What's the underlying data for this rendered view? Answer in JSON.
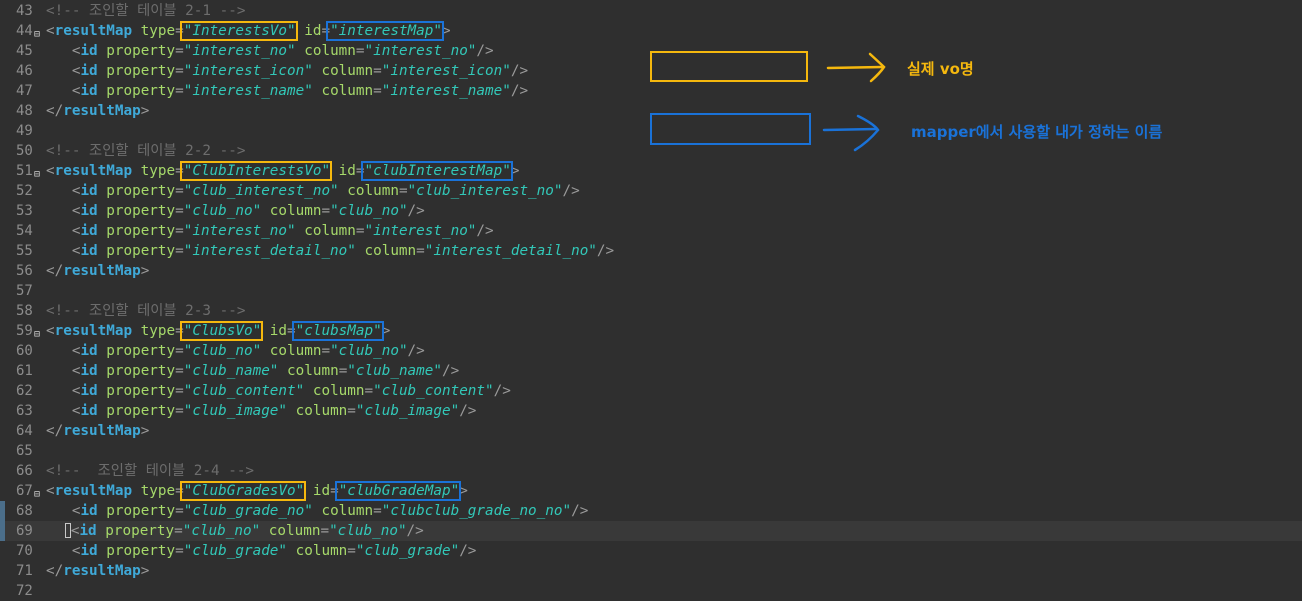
{
  "colors": {
    "vo_highlight": "#f5b80e",
    "mapper_highlight": "#1a72d8",
    "background": "#2f2f2f"
  },
  "legend": {
    "vo_label": "실제 vo명",
    "mapper_label": "mapper에서 사용할 내가 정하는 이름"
  },
  "lines": [
    {
      "n": "43",
      "comment": "<!-- 조인할 테이블 2-1 -->"
    },
    {
      "n": "44",
      "fold": true,
      "open": {
        "tag": "resultMap",
        "type": "InterestsVo",
        "id": "interestMap"
      }
    },
    {
      "n": "45",
      "id": {
        "property": "interest_no",
        "column": "interest_no"
      }
    },
    {
      "n": "46",
      "id": {
        "property": "interest_icon",
        "column": "interest_icon"
      }
    },
    {
      "n": "47",
      "id": {
        "property": "interest_name",
        "column": "interest_name"
      }
    },
    {
      "n": "48",
      "close": "resultMap"
    },
    {
      "n": "49"
    },
    {
      "n": "50",
      "comment": "<!-- 조인할 테이블 2-2 -->"
    },
    {
      "n": "51",
      "fold": true,
      "open": {
        "tag": "resultMap",
        "type": "ClubInterestsVo",
        "id": "clubInterestMap"
      }
    },
    {
      "n": "52",
      "id": {
        "property": "club_interest_no",
        "column": "club_interest_no"
      }
    },
    {
      "n": "53",
      "id": {
        "property": "club_no",
        "column": "club_no"
      }
    },
    {
      "n": "54",
      "id": {
        "property": "interest_no",
        "column": "interest_no"
      }
    },
    {
      "n": "55",
      "id": {
        "property": "interest_detail_no",
        "column": "interest_detail_no"
      }
    },
    {
      "n": "56",
      "close": "resultMap"
    },
    {
      "n": "57"
    },
    {
      "n": "58",
      "comment": "<!-- 조인할 테이블 2-3 -->"
    },
    {
      "n": "59",
      "fold": true,
      "open": {
        "tag": "resultMap",
        "type": "ClubsVo",
        "id": "clubsMap"
      }
    },
    {
      "n": "60",
      "id": {
        "property": "club_no",
        "column": "club_no"
      }
    },
    {
      "n": "61",
      "id": {
        "property": "club_name",
        "column": "club_name"
      }
    },
    {
      "n": "62",
      "id": {
        "property": "club_content",
        "column": "club_content"
      }
    },
    {
      "n": "63",
      "id": {
        "property": "club_image",
        "column": "club_image"
      }
    },
    {
      "n": "64",
      "close": "resultMap"
    },
    {
      "n": "65"
    },
    {
      "n": "66",
      "comment": "<!--  조인할 테이블 2-4 -->"
    },
    {
      "n": "67",
      "fold": true,
      "open": {
        "tag": "resultMap",
        "type": "ClubGradesVo",
        "id": "clubGradeMap"
      }
    },
    {
      "n": "68",
      "mark": true,
      "id": {
        "property": "club_grade_no",
        "column": "clubclub_grade_no_no"
      }
    },
    {
      "n": "69",
      "mark": true,
      "current": true,
      "cursor": true,
      "id": {
        "property": "club_no",
        "column": "club_no"
      }
    },
    {
      "n": "70",
      "id": {
        "property": "club_grade",
        "column": "club_grade"
      }
    },
    {
      "n": "71",
      "close": "resultMap"
    },
    {
      "n": "72"
    }
  ]
}
